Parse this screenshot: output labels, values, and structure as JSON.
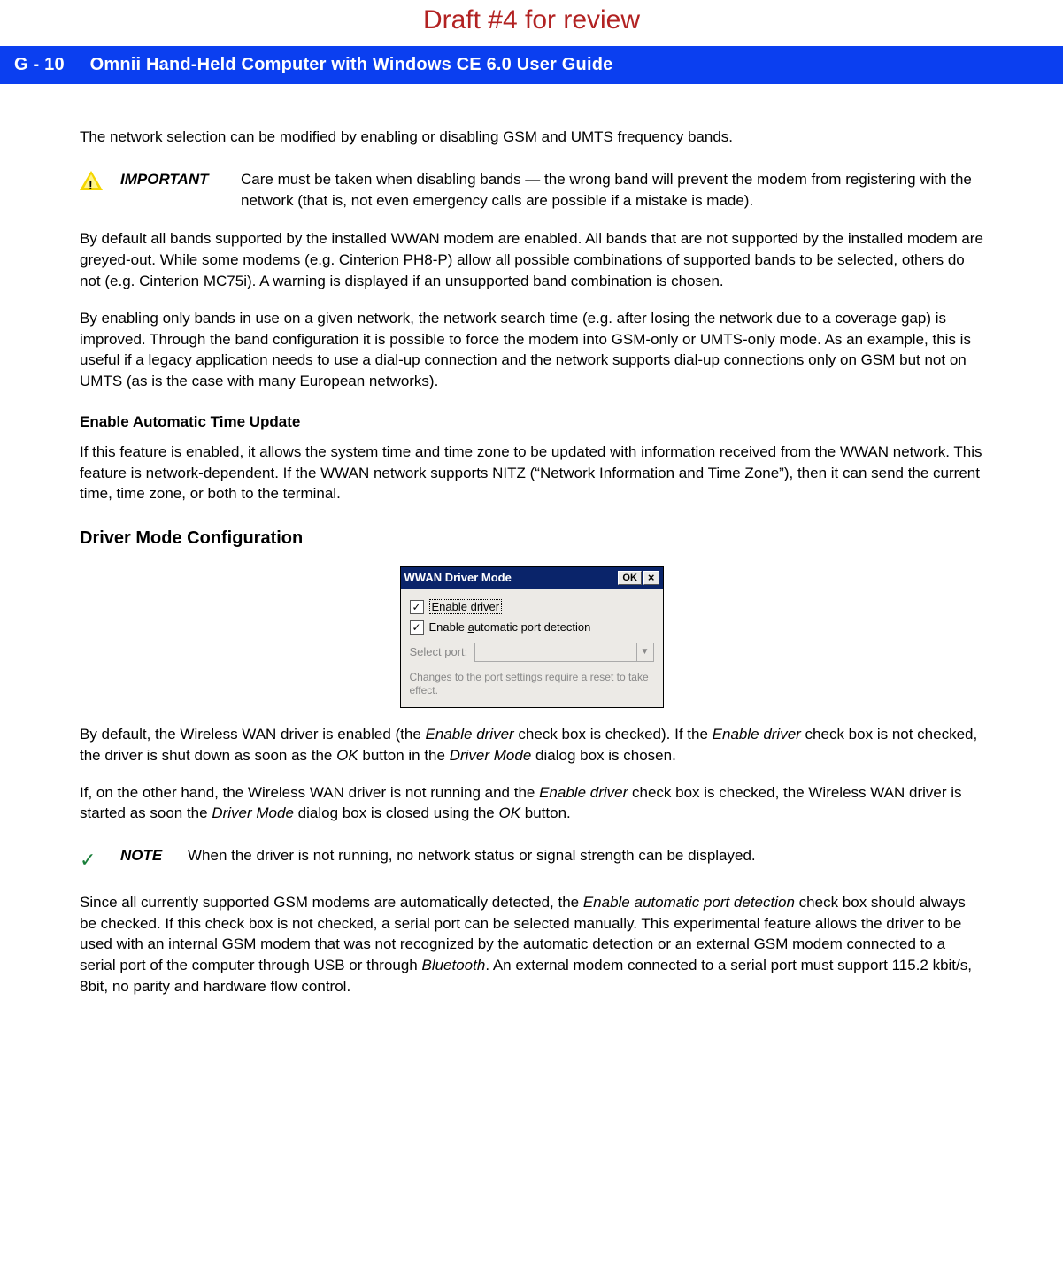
{
  "draft_header": "Draft #4 for review",
  "bluebar": {
    "page_ref": "G - 10",
    "title": "Omnii Hand-Held Computer with Windows CE 6.0 User Guide"
  },
  "para_intro": "The network selection can be modified by enabling or disabling GSM and UMTS frequency bands.",
  "important": {
    "label": "IMPORTANT",
    "text": "Care must be taken when disabling bands — the wrong band will prevent the modem from registering with the network (that is, not even emergency calls are possible if a mistake is made)."
  },
  "para_bands1": "By default all bands supported by the installed WWAN modem are enabled. All bands that are not supported by the installed modem are greyed-out. While some modems (e.g. Cinterion PH8-P) allow all possible combinations of supported bands to be selected, others do not (e.g. Cinterion MC75i). A warning is displayed if an unsupported band combination is chosen.",
  "para_bands2": "By enabling only bands in use on a given network, the network search time (e.g. after losing the network due to a coverage gap) is improved. Through the band configuration it is possible to force the modem into GSM-only or UMTS-only mode. As an example, this is useful if a legacy application needs to use a dial-up connection and the network supports dial-up connections only on GSM but not on UMTS (as is the case with many European networks).",
  "subhead_enable_auto_time": "Enable Automatic Time Update",
  "para_auto_time": "If this feature is enabled, it allows the system time and time zone to be updated with information received from the WWAN network. This feature is network-dependent. If the WWAN network supports NITZ (“Network Information and Time Zone”), then it can send the current time, time zone, or both to the terminal.",
  "section_driver_mode": "Driver Mode Configuration",
  "dialog": {
    "title": "WWAN Driver Mode",
    "ok": "OK",
    "close": "×",
    "cb1_pre": "Enable ",
    "cb1_u": "d",
    "cb1_post": "river",
    "cb2_pre": "Enable ",
    "cb2_u": "a",
    "cb2_post": "utomatic port detection",
    "select_label": "Select port:",
    "hint": "Changes to the port settings require a reset to take effect."
  },
  "para_driver1_a": "By default, the Wireless WAN driver is enabled (the ",
  "para_driver1_em1": "Enable driver",
  "para_driver1_b": " check box is checked). If the ",
  "para_driver1_em2": "Enable driver",
  "para_driver1_c": " check box is not checked, the driver is shut down as soon as the ",
  "para_driver1_em3": "OK",
  "para_driver1_d": " button in the ",
  "para_driver1_em4": "Driver Mode",
  "para_driver1_e": " dialog box is chosen.",
  "para_driver2_a": "If, on the other hand, the Wireless WAN driver is not running and the ",
  "para_driver2_em1": "Enable driver",
  "para_driver2_b": " check box is checked, the Wireless WAN driver is started as soon the ",
  "para_driver2_em2": "Driver Mode",
  "para_driver2_c": " dialog box is closed using the ",
  "para_driver2_em3": "OK",
  "para_driver2_d": " button.",
  "note": {
    "label": "NOTE",
    "text": "When the driver is not running, no network status or signal strength can be displayed."
  },
  "para_port_a": "Since all currently supported GSM modems are automatically detected, the ",
  "para_port_em1": "Enable automatic port detection",
  "para_port_b": " check box should always be checked. If this check box is not checked, a serial port can be selected manually. This experimental feature allows the driver to be used with an internal GSM modem that was not recognized by the automatic detection or an external GSM modem connected to a serial port of the computer through USB or through ",
  "para_port_em2": "Bluetooth",
  "para_port_c": ". An external modem connected to a serial port must support 115.2 kbit/s, 8bit, no parity and hardware flow control."
}
